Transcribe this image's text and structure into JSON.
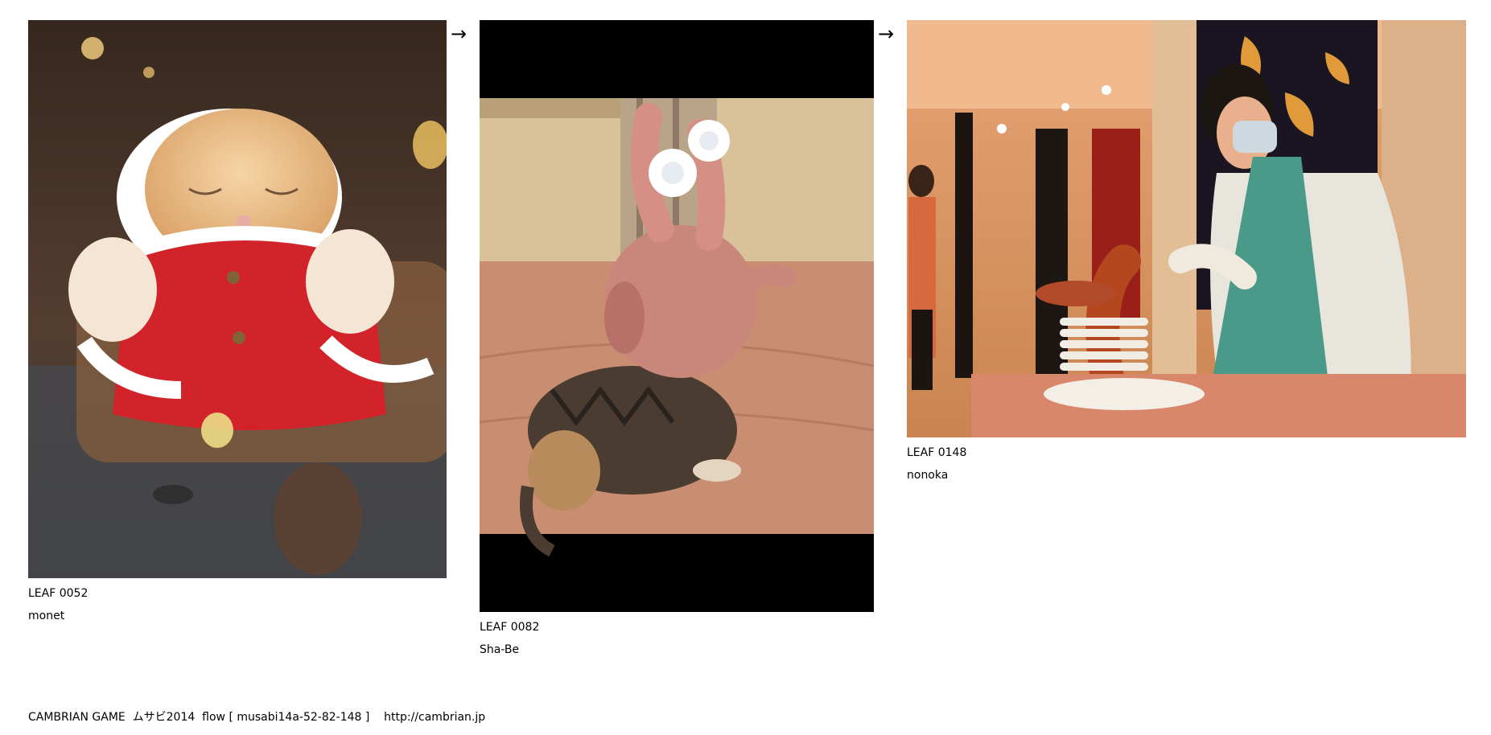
{
  "leaves": [
    {
      "id": "LEAF 0052",
      "author": "monet"
    },
    {
      "id": "LEAF 0082",
      "author": "Sha-Be"
    },
    {
      "id": "LEAF 0148",
      "author": "nonoka"
    }
  ],
  "arrows": [
    "→",
    "→"
  ],
  "footer": {
    "text": "CAMBRIAN GAME  ムサビ2014  flow [ musabi14a-52-82-148 ]    http://cambrian.jp"
  }
}
